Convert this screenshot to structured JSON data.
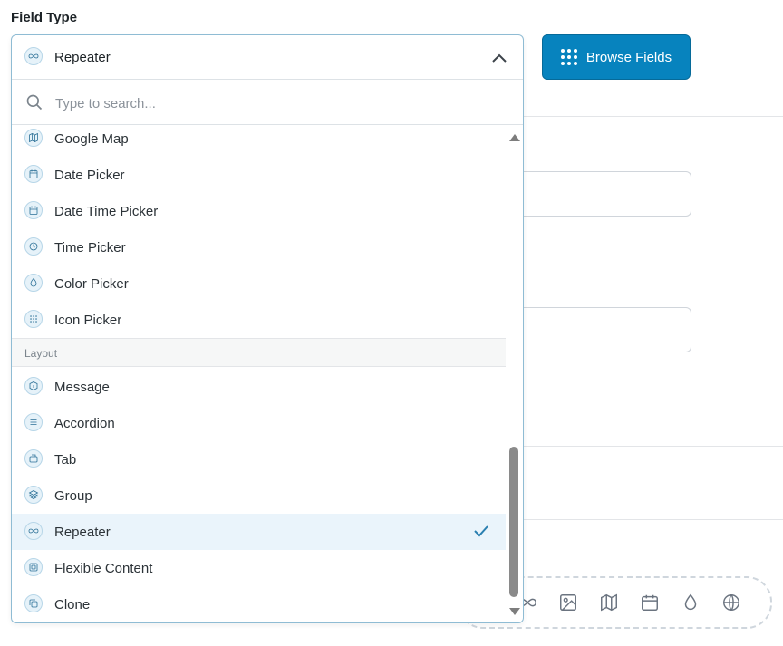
{
  "field_label": "Field Type",
  "browse_button": "Browse Fields",
  "select": {
    "value": "Repeater",
    "search_placeholder": "Type to search..."
  },
  "items_top": [
    {
      "label": "Google Map",
      "icon": "map-icon"
    },
    {
      "label": "Date Picker",
      "icon": "calendar-icon"
    },
    {
      "label": "Date Time Picker",
      "icon": "calendar-icon"
    },
    {
      "label": "Time Picker",
      "icon": "clock-icon"
    },
    {
      "label": "Color Picker",
      "icon": "droplet-icon"
    },
    {
      "label": "Icon Picker",
      "icon": "grid-icon"
    }
  ],
  "group_layout": "Layout",
  "items_layout": [
    {
      "label": "Message",
      "icon": "info-icon"
    },
    {
      "label": "Accordion",
      "icon": "accordion-icon"
    },
    {
      "label": "Tab",
      "icon": "tab-icon"
    },
    {
      "label": "Group",
      "icon": "layers-icon"
    },
    {
      "label": "Repeater",
      "icon": "infinity-icon",
      "selected": true
    },
    {
      "label": "Flexible Content",
      "icon": "flexible-icon"
    },
    {
      "label": "Clone",
      "icon": "clone-icon"
    }
  ],
  "colors": {
    "accent": "#0783be",
    "selected_bg": "#eaf4fb",
    "border": "#8fbcd4"
  }
}
